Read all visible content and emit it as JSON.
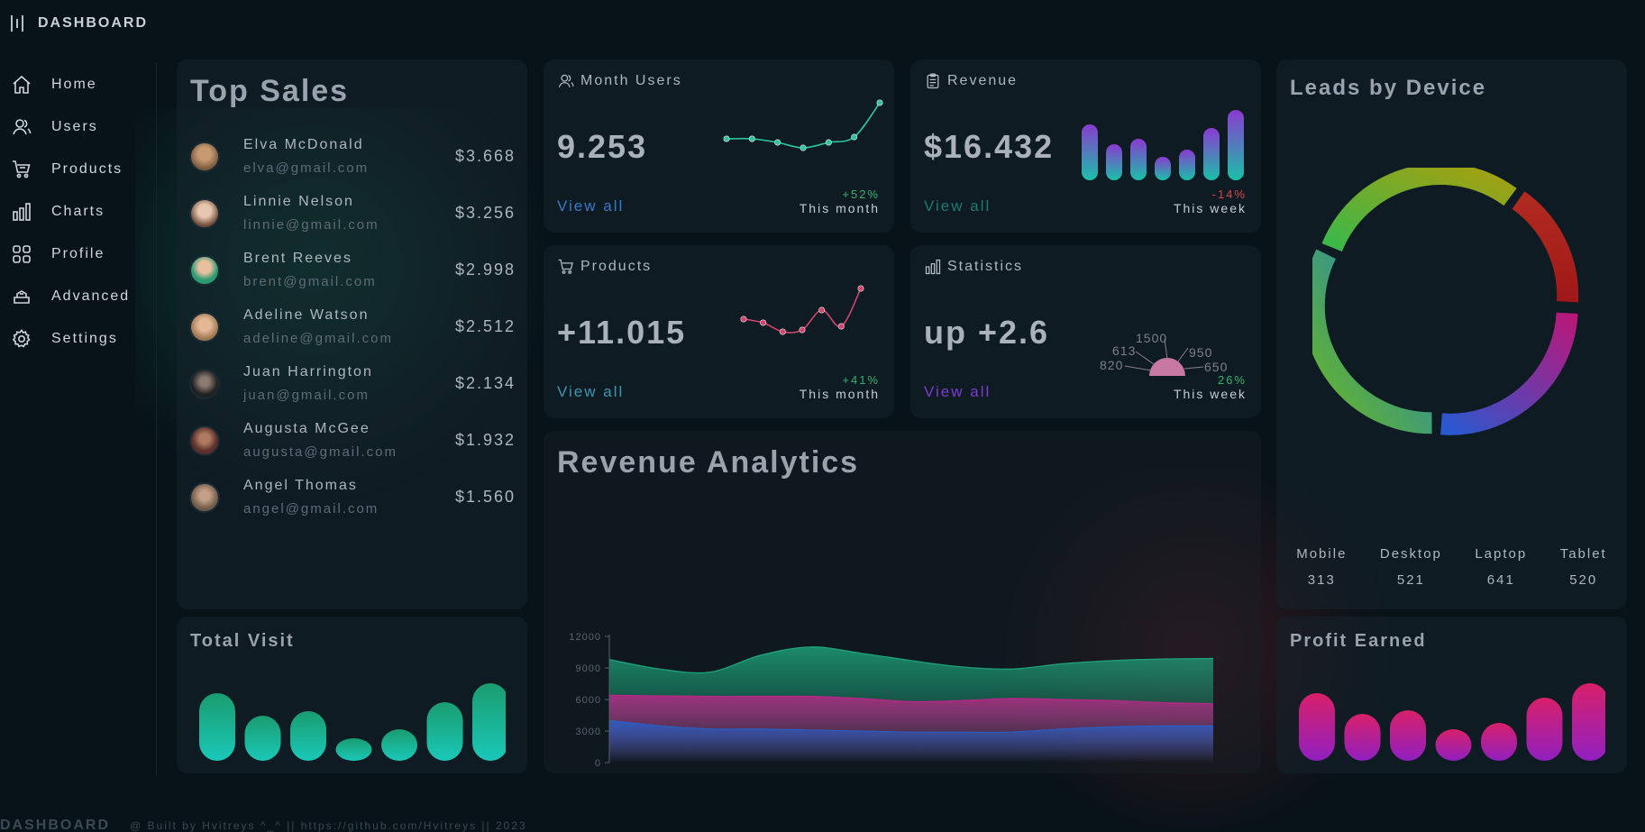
{
  "brand": {
    "title": "DASHBOARD"
  },
  "sidebar": {
    "items": [
      {
        "label": "Home",
        "icon": "home-icon"
      },
      {
        "label": "Users",
        "icon": "users-icon"
      },
      {
        "label": "Products",
        "icon": "cart-icon"
      },
      {
        "label": "Charts",
        "icon": "bar-chart-icon"
      },
      {
        "label": "Profile",
        "icon": "grid-icon"
      },
      {
        "label": "Advanced",
        "icon": "layers-icon"
      },
      {
        "label": "Settings",
        "icon": "gear-icon"
      }
    ]
  },
  "top_sales": {
    "title": "Top Sales",
    "rows": [
      {
        "name": "Elva McDonald",
        "email": "elva@gmail.com",
        "amount": "$3.668",
        "avatar_color": "#7a5a3c"
      },
      {
        "name": "Linnie Nelson",
        "email": "linnie@gmail.com",
        "amount": "$3.256",
        "avatar_color": "#8a6a50"
      },
      {
        "name": "Brent Reeves",
        "email": "brent@gmail.com",
        "amount": "$2.998",
        "avatar_color": "#2c9a70"
      },
      {
        "name": "Adeline Watson",
        "email": "adeline@gmail.com",
        "amount": "$2.512",
        "avatar_color": "#9c7650"
      },
      {
        "name": "Juan Harrington",
        "email": "juan@gmail.com",
        "amount": "$2.134",
        "avatar_color": "#3a3a3a"
      },
      {
        "name": "Augusta McGee",
        "email": "augusta@gmail.com",
        "amount": "$1.932",
        "avatar_color": "#5a2e2a"
      },
      {
        "name": "Angel Thomas",
        "email": "angel@gmail.com",
        "amount": "$1.560",
        "avatar_color": "#6e5a48"
      }
    ]
  },
  "cards": {
    "users": {
      "title": "Month Users",
      "value": "9.253",
      "view_all": "View all",
      "pct": "+52%",
      "period": "This month",
      "accent": "#3aa6c8",
      "line_color": "#2ec49a",
      "points": [
        42,
        42,
        38,
        32,
        38,
        44,
        82
      ]
    },
    "revenue": {
      "title": "Revenue",
      "value": "$16.432",
      "view_all": "View all",
      "pct": "-14%",
      "period": "This week",
      "accent": "#1a7a74",
      "bars": [
        62,
        40,
        46,
        26,
        34,
        58,
        78
      ]
    },
    "products": {
      "title": "Products",
      "value": "+11.015",
      "view_all": "View all",
      "pct": "+41%",
      "period": "This month",
      "accent": "#3aa0b8",
      "line_color": "#d0456e",
      "points": [
        48,
        44,
        34,
        36,
        58,
        40,
        82
      ]
    },
    "stats": {
      "title": "Statistics",
      "value": "up +2.6",
      "view_all": "View all",
      "pct": "26%",
      "period": "This week",
      "accent": "#7d3ccf",
      "gauge_labels": [
        "820",
        "613",
        "1500",
        "950",
        "650"
      ]
    }
  },
  "analytics": {
    "title": "Revenue Analytics"
  },
  "chart_data": {
    "type": "area",
    "title": "Revenue Analytics",
    "x": [
      0,
      1,
      2,
      3,
      4,
      5,
      6,
      7,
      8,
      9,
      10,
      11,
      12
    ],
    "ylim": [
      0,
      12000
    ],
    "yticks": [
      "0",
      "3000",
      "6000",
      "9000",
      "12000"
    ],
    "series": [
      {
        "color": "#1fb083",
        "values": [
          9800,
          8900,
          8600,
          10200,
          11000,
          10400,
          9700,
          9100,
          8900,
          9400,
          9700,
          9850,
          9900
        ]
      },
      {
        "color": "#c2258a",
        "values": [
          6400,
          6350,
          6300,
          6300,
          6300,
          6100,
          5800,
          5900,
          6100,
          6000,
          5900,
          5700,
          5600
        ]
      },
      {
        "color": "#2860c8",
        "values": [
          4000,
          3500,
          3200,
          3200,
          3100,
          3000,
          2900,
          2900,
          2900,
          3200,
          3400,
          3500,
          3500
        ]
      }
    ]
  },
  "leads": {
    "title": "Leads by Device",
    "devices": [
      {
        "label": "Mobile",
        "value": "313"
      },
      {
        "label": "Desktop",
        "value": "521"
      },
      {
        "label": "Laptop",
        "value": "641"
      },
      {
        "label": "Tablet",
        "value": "520"
      }
    ]
  },
  "visit": {
    "title": "Total Visit",
    "bars": [
      75,
      50,
      55,
      25,
      35,
      65,
      86
    ]
  },
  "profit": {
    "title": "Profit Earned",
    "bars": [
      75,
      52,
      56,
      35,
      42,
      70,
      86
    ]
  },
  "footer": {
    "brand": "DASHBOARD",
    "text": "@ Built by Hvitreys ^_^ || https://github.com/Hvitreys || 2023"
  }
}
